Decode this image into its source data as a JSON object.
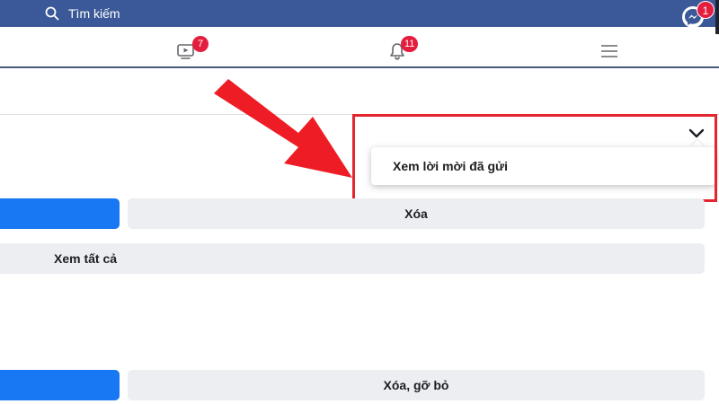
{
  "header": {
    "search_label": "Tìm kiếm",
    "messenger_badge": "1"
  },
  "nav": {
    "watch_badge": "7",
    "notifications_badge": "11"
  },
  "dropdown": {
    "item_label": "Xem lời mời đã gửi"
  },
  "requests": {
    "delete_label": "Xóa",
    "see_all_label": "Xem tất cả",
    "delete_remove_label": "Xóa, gỡ bỏ"
  },
  "colors": {
    "header_blue": "#3b5998",
    "primary_button": "#1877f2",
    "badge_red": "#e41e3f",
    "highlight_red": "#e3262e",
    "secondary_button": "#eceef2"
  }
}
